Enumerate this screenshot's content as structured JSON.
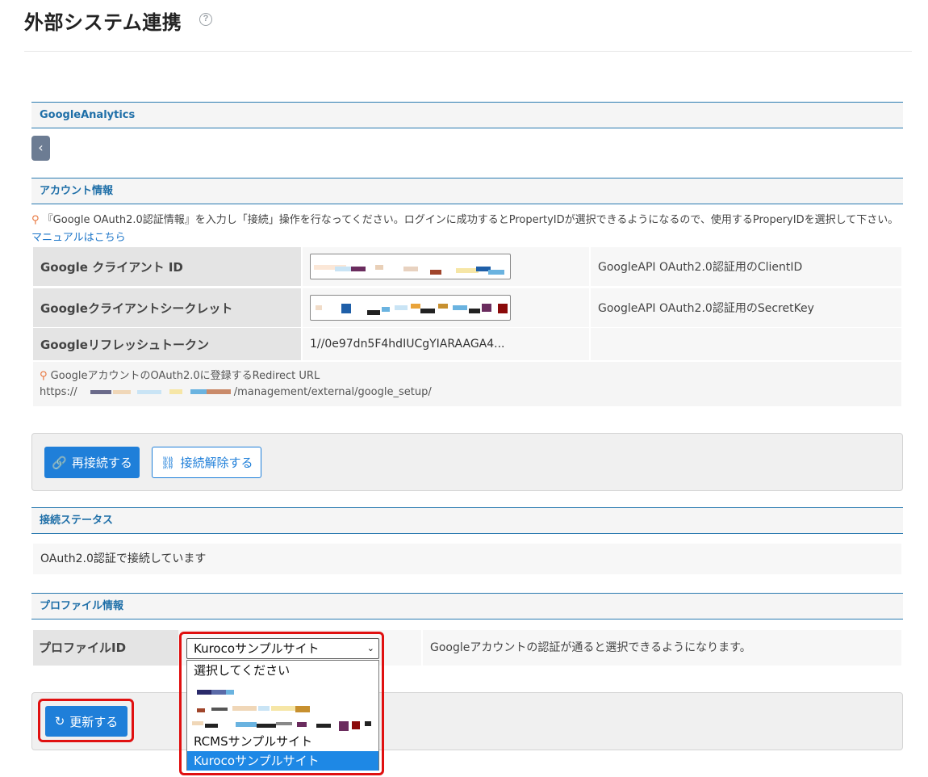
{
  "page": {
    "title": "外部システム連携",
    "help_icon": "question-circle-icon"
  },
  "section_ga": {
    "title": "GoogleAnalytics"
  },
  "back_button": {
    "icon": "chevron-left-icon",
    "label": "‹"
  },
  "account": {
    "title": "アカウント情報",
    "note_icon": "lightbulb-icon",
    "note_text": "『Google OAuth2.0認証情報』を入力し「接続」操作を行なってください。ログインに成功するとPropertyIDが選択できるようになるので、使用するProperyIDを選択して下さい。",
    "manual_link": "マニュアルはこちら",
    "rows": [
      {
        "label": "Google クライアント ID",
        "value": "",
        "masked": true,
        "desc": "GoogleAPI OAuth2.0認証用のClientID"
      },
      {
        "label": "Googleクライアントシークレット",
        "value": "",
        "masked": true,
        "desc": "GoogleAPI OAuth2.0認証用のSecretKey"
      },
      {
        "label": "Googleリフレッシュトークン",
        "value": "1//0e97dn5F4hdIUCgYIARAAGA4...",
        "masked": false,
        "desc": ""
      }
    ],
    "redirect_label": "GoogleアカウントのOAuth2.0に登録するRedirect URL",
    "redirect_prefix": "https://",
    "redirect_suffix": "/management/external/google_setup/"
  },
  "connect_actions": {
    "reconnect_label": "再接続する",
    "reconnect_icon": "link-icon",
    "disconnect_label": "接続解除する",
    "disconnect_icon": "unlink-icon"
  },
  "status": {
    "title": "接続ステータス",
    "text": "OAuth2.0認証で接続しています"
  },
  "profile": {
    "title": "プロファイル情報",
    "label": "プロファイルID",
    "selected": "Kurocoサンプルサイト",
    "desc": "Googleアカウントの認証が通ると選択できるようになります。",
    "options": [
      "選択してください",
      "",
      "",
      "",
      "RCMSサンプルサイト",
      "Kurocoサンプルサイト"
    ]
  },
  "update": {
    "label": "更新する",
    "icon": "refresh-icon"
  },
  "colors": {
    "accent": "#1f7fd9",
    "section_border": "#2a7ab0",
    "highlight": "#e01010"
  }
}
